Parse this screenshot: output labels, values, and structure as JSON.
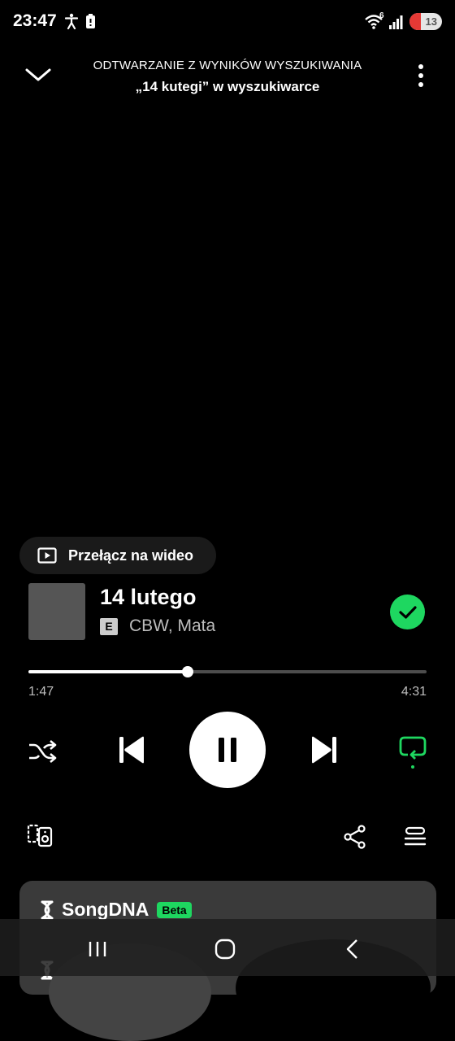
{
  "status": {
    "time": "23:47",
    "wifi_badge": "6",
    "battery": "13",
    "icons": [
      "accessibility-icon",
      "battery-saver-icon",
      "wifi-icon",
      "signal-icon"
    ]
  },
  "header": {
    "context_label": "ODTWARZANIE Z WYNIKÓW WYSZUKIWANIA",
    "context_source": "„14 kutegi” w wyszukiwarce"
  },
  "video_toggle": {
    "label": "Przełącz na wideo"
  },
  "track": {
    "title": "14 lutego",
    "explicit_badge": "E",
    "artists": "CBW, Mata",
    "liked": true
  },
  "playback": {
    "elapsed": "1:47",
    "total": "4:31",
    "progress": 0.4,
    "state": "playing",
    "repeat": true
  },
  "colors": {
    "accent": "#1ed760",
    "background": "#000000",
    "secondary_text": "#bdbdbd"
  },
  "songdna": {
    "name": "SongDNA",
    "badge": "Beta"
  }
}
